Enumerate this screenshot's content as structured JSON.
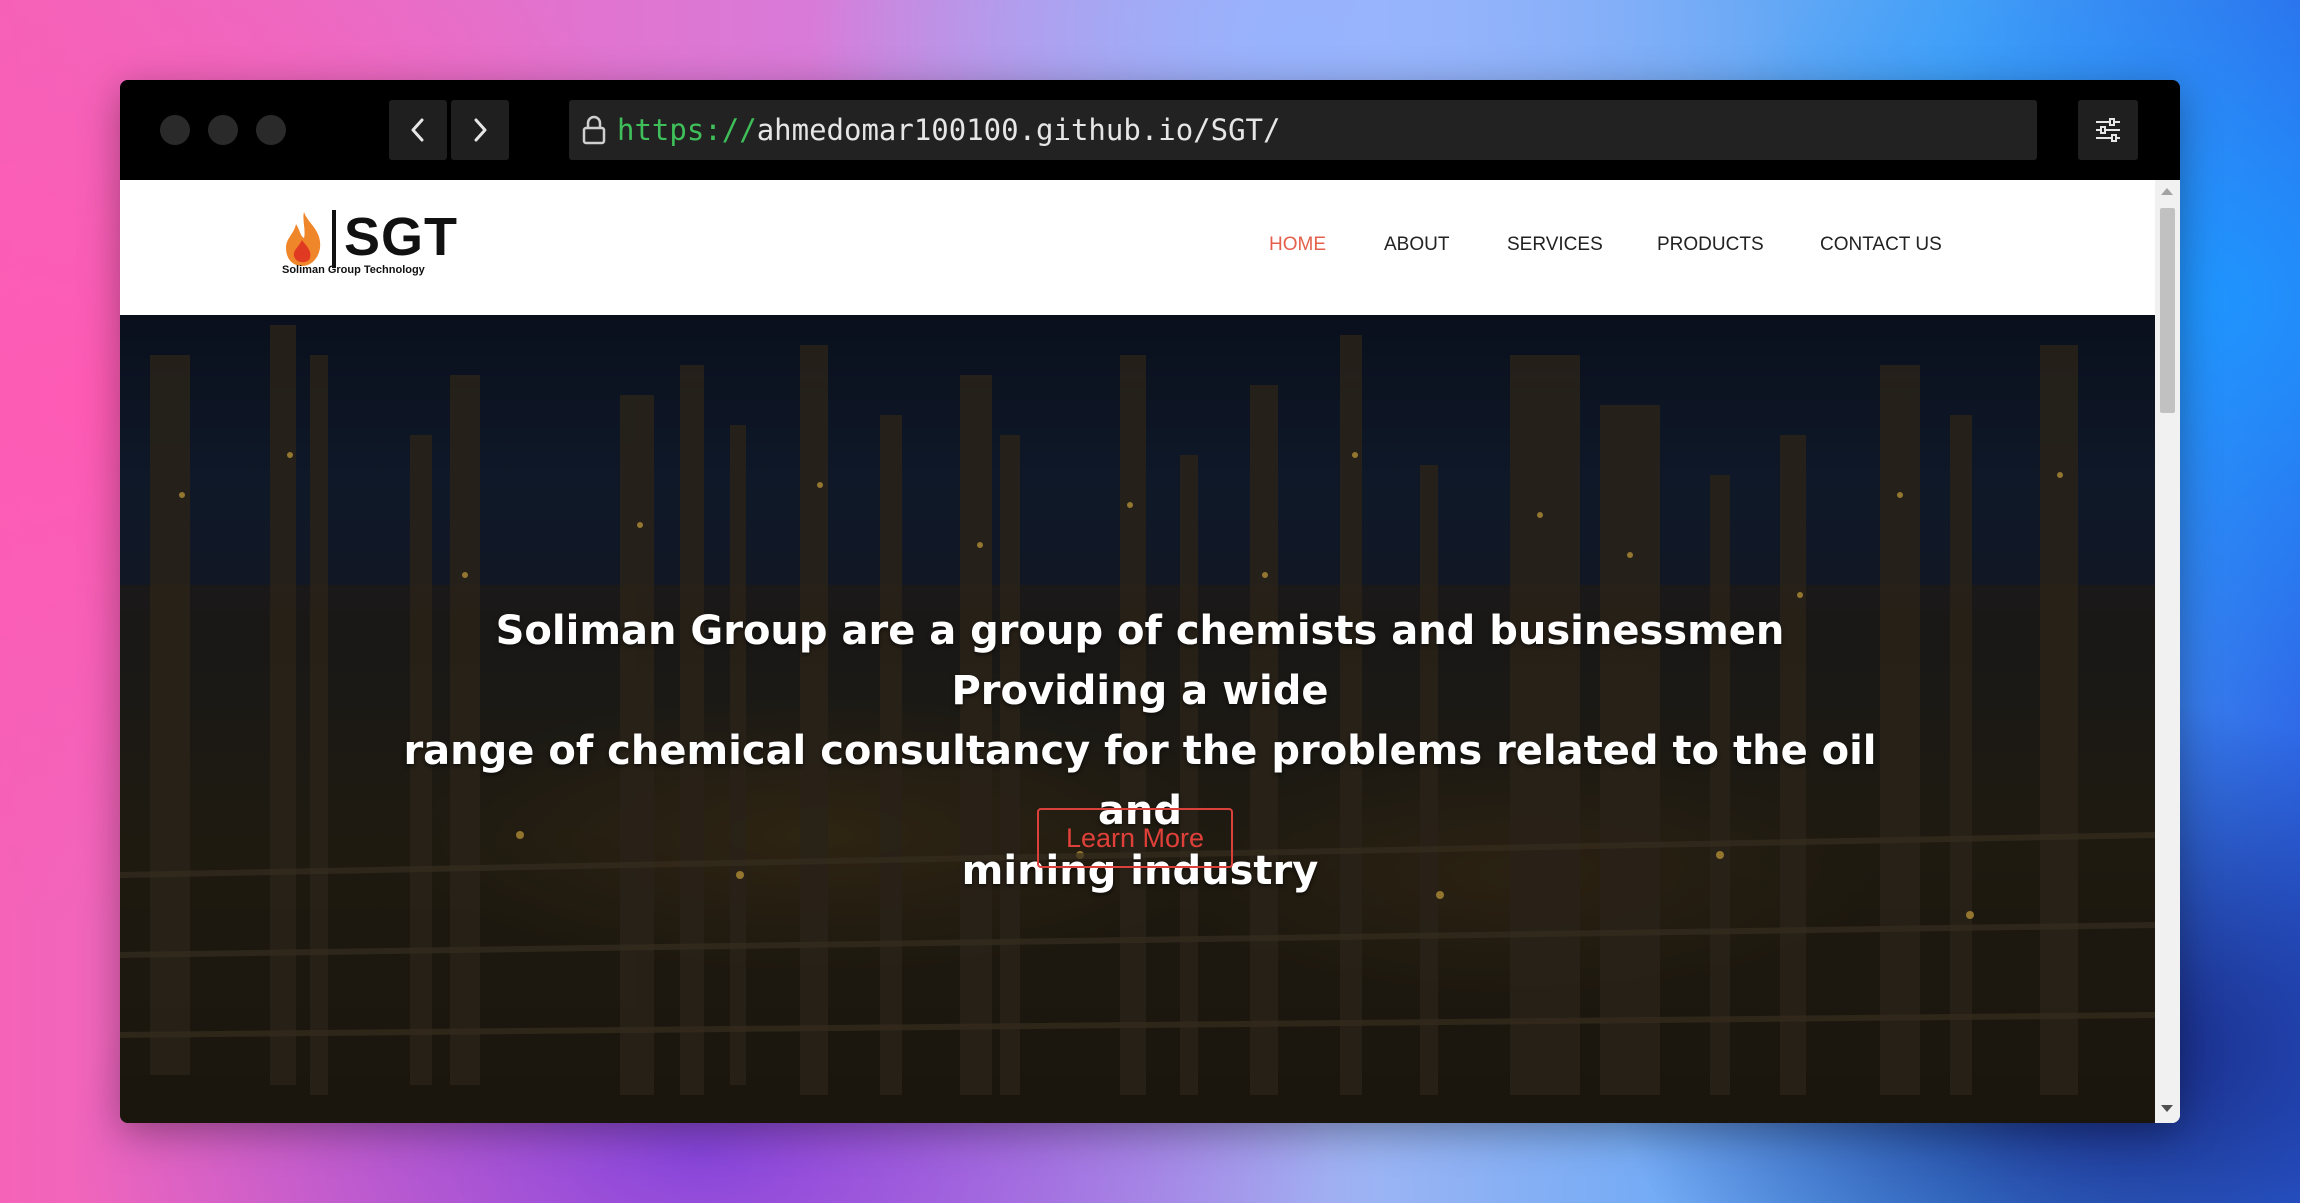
{
  "browser": {
    "url_scheme": "https://",
    "url_rest": "ahmedomar100100.github.io/SGT/"
  },
  "site": {
    "logo_text": "SGT",
    "logo_subtitle": "Soliman Group Technology",
    "nav": [
      {
        "label": "HOME",
        "active": true
      },
      {
        "label": "ABOUT",
        "active": false
      },
      {
        "label": "SERVICES",
        "active": false
      },
      {
        "label": "PRODUCTS",
        "active": false
      },
      {
        "label": "CONTACT US",
        "active": false
      }
    ],
    "hero": {
      "line1": "Soliman Group are a group of chemists and businessmen Providing a wide",
      "line2": "range of chemical consultancy for the problems related to the oil and",
      "line3": "mining industry",
      "button_label": "Learn More"
    }
  },
  "colors": {
    "nav_active": "#e4604c",
    "button_accent": "#d9413a",
    "url_scheme": "#3fbf5a"
  }
}
